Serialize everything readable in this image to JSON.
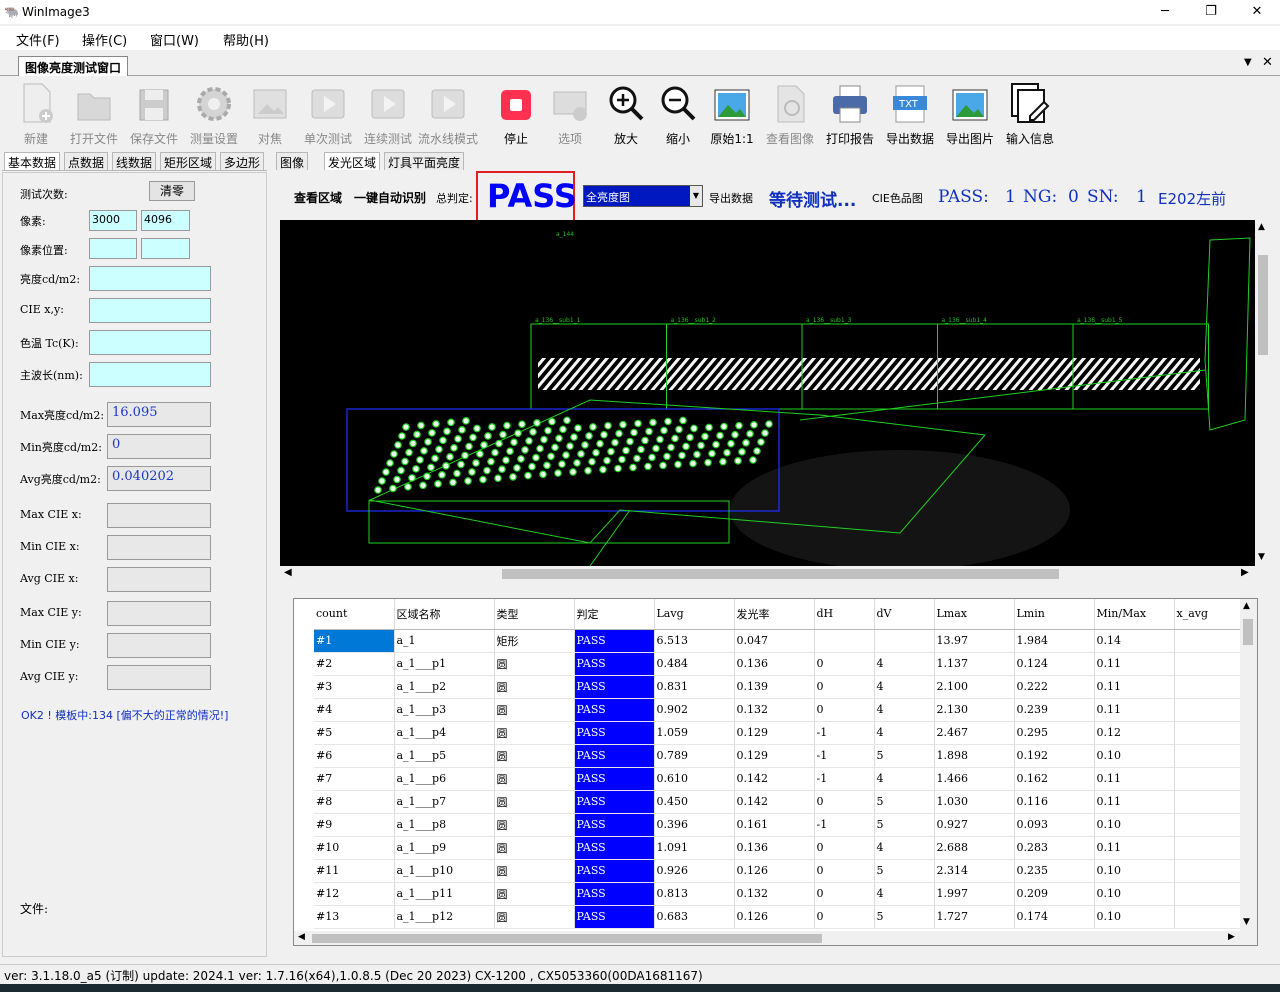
{
  "window": {
    "title": "WinImage3"
  },
  "menu": [
    "文件(F)",
    "操作(C)",
    "窗口(W)",
    "帮助(H)"
  ],
  "doc_tab": "图像亮度测试窗口",
  "toolbar": [
    {
      "label": "新建",
      "icon": "new-file-icon",
      "enabled": false
    },
    {
      "label": "打开文件",
      "icon": "folder-icon",
      "enabled": false
    },
    {
      "label": "保存文件",
      "icon": "save-icon",
      "enabled": false
    },
    {
      "label": "测量设置",
      "icon": "gear-icon",
      "enabled": false
    },
    {
      "label": "对焦",
      "icon": "image-icon",
      "enabled": false
    },
    {
      "label": "单次测试",
      "icon": "play-icon",
      "enabled": false
    },
    {
      "label": "连续测试",
      "icon": "play-icon",
      "enabled": false
    },
    {
      "label": "流水线模式",
      "icon": "play-icon",
      "enabled": false
    },
    {
      "label": "停止",
      "icon": "stop-icon",
      "enabled": true
    },
    {
      "label": "选项",
      "icon": "options-icon",
      "enabled": false
    },
    {
      "label": "放大",
      "icon": "zoom-in-icon",
      "enabled": true
    },
    {
      "label": "缩小",
      "icon": "zoom-out-icon",
      "enabled": true
    },
    {
      "label": "原始1:1",
      "icon": "picture-icon",
      "enabled": true
    },
    {
      "label": "查看图像",
      "icon": "view-image-icon",
      "enabled": false
    },
    {
      "label": "打印报告",
      "icon": "printer-icon",
      "enabled": true
    },
    {
      "label": "导出数据",
      "icon": "txt-icon",
      "enabled": true
    },
    {
      "label": "导出图片",
      "icon": "picture-icon",
      "enabled": true
    },
    {
      "label": "输入信息",
      "icon": "edit-icon",
      "enabled": true
    }
  ],
  "left_tabs": [
    "基本数据",
    "点数据",
    "线数据",
    "矩形区域",
    "多边形"
  ],
  "right_tabs": [
    "图像",
    "发光区域",
    "灯具平面亮度"
  ],
  "left_panel": {
    "test_count_label": "测试次数:",
    "clear_button": "清零",
    "pixels_label": "像素:",
    "pixel_w": "3000",
    "pixel_h": "4096",
    "pixel_pos_label": "像素位置:",
    "luminance_label": "亮度cd/m2:",
    "cie_xy_label": "CIE x,y:",
    "cct_label": "色温 Tc(K):",
    "wavelength_label": "主波长(nm):",
    "max_lum_label": "Max亮度cd/m2:",
    "max_lum": "16.095",
    "min_lum_label": "Min亮度cd/m2:",
    "min_lum": "0",
    "avg_lum_label": "Avg亮度cd/m2:",
    "avg_lum": "0.040202",
    "max_cie_x_label": "Max CIE x:",
    "min_cie_x_label": "Min CIE x:",
    "avg_cie_x_label": "Avg CIE x:",
    "max_cie_y_label": "Max CIE y:",
    "min_cie_y_label": "Min CIE y:",
    "avg_cie_y_label": "Avg CIE y:",
    "message": "OK2 ! 模板中:134 [偏不大的正常的情况!]",
    "file_label": "文件:"
  },
  "top_bar": {
    "view_area": "查看区域",
    "auto_identify": "一键自动识别",
    "overall_label": "总判定:",
    "overall_result": "PASS",
    "view_select": "全亮度图",
    "export_data": "导出数据",
    "waiting": "等待测试...",
    "cie_chart": "CIE色品图",
    "pass_label": "PASS:",
    "pass_count": "1",
    "ng_label": "NG:",
    "ng_count": "0",
    "sn_label": "SN:",
    "sn_count": "1",
    "position": "E202左前"
  },
  "image_labels": {
    "top": "a_144",
    "subs": [
      "a_136__sub1_1",
      "a_136__sub1_2",
      "a_136__sub1_3",
      "a_136__sub1_4",
      "a_136__sub1_5"
    ]
  },
  "table": {
    "columns": [
      "count",
      "区域名称",
      "类型",
      "判定",
      "Lavg",
      "发光率",
      "dH",
      "dV",
      "Lmax",
      "Lmin",
      "Min/Max",
      "x_avg"
    ],
    "rows": [
      [
        "#1",
        "a_1",
        "矩形",
        "PASS",
        "6.513",
        "0.047",
        "",
        "",
        "13.97",
        "1.984",
        "0.14",
        ""
      ],
      [
        "#2",
        "a_1___p1",
        "圆",
        "PASS",
        "0.484",
        "0.136",
        "0",
        "4",
        "1.137",
        "0.124",
        "0.11",
        ""
      ],
      [
        "#3",
        "a_1___p2",
        "圆",
        "PASS",
        "0.831",
        "0.139",
        "0",
        "4",
        "2.100",
        "0.222",
        "0.11",
        ""
      ],
      [
        "#4",
        "a_1___p3",
        "圆",
        "PASS",
        "0.902",
        "0.132",
        "0",
        "4",
        "2.130",
        "0.239",
        "0.11",
        ""
      ],
      [
        "#5",
        "a_1___p4",
        "圆",
        "PASS",
        "1.059",
        "0.129",
        "-1",
        "4",
        "2.467",
        "0.295",
        "0.12",
        ""
      ],
      [
        "#6",
        "a_1___p5",
        "圆",
        "PASS",
        "0.789",
        "0.129",
        "-1",
        "5",
        "1.898",
        "0.192",
        "0.10",
        ""
      ],
      [
        "#7",
        "a_1___p6",
        "圆",
        "PASS",
        "0.610",
        "0.142",
        "-1",
        "4",
        "1.466",
        "0.162",
        "0.11",
        ""
      ],
      [
        "#8",
        "a_1___p7",
        "圆",
        "PASS",
        "0.450",
        "0.142",
        "0",
        "5",
        "1.030",
        "0.116",
        "0.11",
        ""
      ],
      [
        "#9",
        "a_1___p8",
        "圆",
        "PASS",
        "0.396",
        "0.161",
        "-1",
        "5",
        "0.927",
        "0.093",
        "0.10",
        ""
      ],
      [
        "#10",
        "a_1___p9",
        "圆",
        "PASS",
        "1.091",
        "0.136",
        "0",
        "4",
        "2.688",
        "0.283",
        "0.11",
        ""
      ],
      [
        "#11",
        "a_1___p10",
        "圆",
        "PASS",
        "0.926",
        "0.126",
        "0",
        "5",
        "2.314",
        "0.235",
        "0.10",
        ""
      ],
      [
        "#12",
        "a_1___p11",
        "圆",
        "PASS",
        "0.813",
        "0.132",
        "0",
        "4",
        "1.997",
        "0.209",
        "0.10",
        ""
      ],
      [
        "#13",
        "a_1___p12",
        "圆",
        "PASS",
        "0.683",
        "0.126",
        "0",
        "5",
        "1.727",
        "0.174",
        "0.10",
        ""
      ]
    ]
  },
  "status": "ver: 3.1.18.0_a5 (订制) update: 2024.1  ver: 1.7.16(x64),1.0.8.5 (Dec 20 2023)  CX-1200 , CX5053360(00DA1681167)",
  "colors": {
    "pass_blue": "#0000ff",
    "accent_red": "#e02020",
    "overlay_green": "#20d020",
    "overlay_blue": "#2030ff"
  }
}
